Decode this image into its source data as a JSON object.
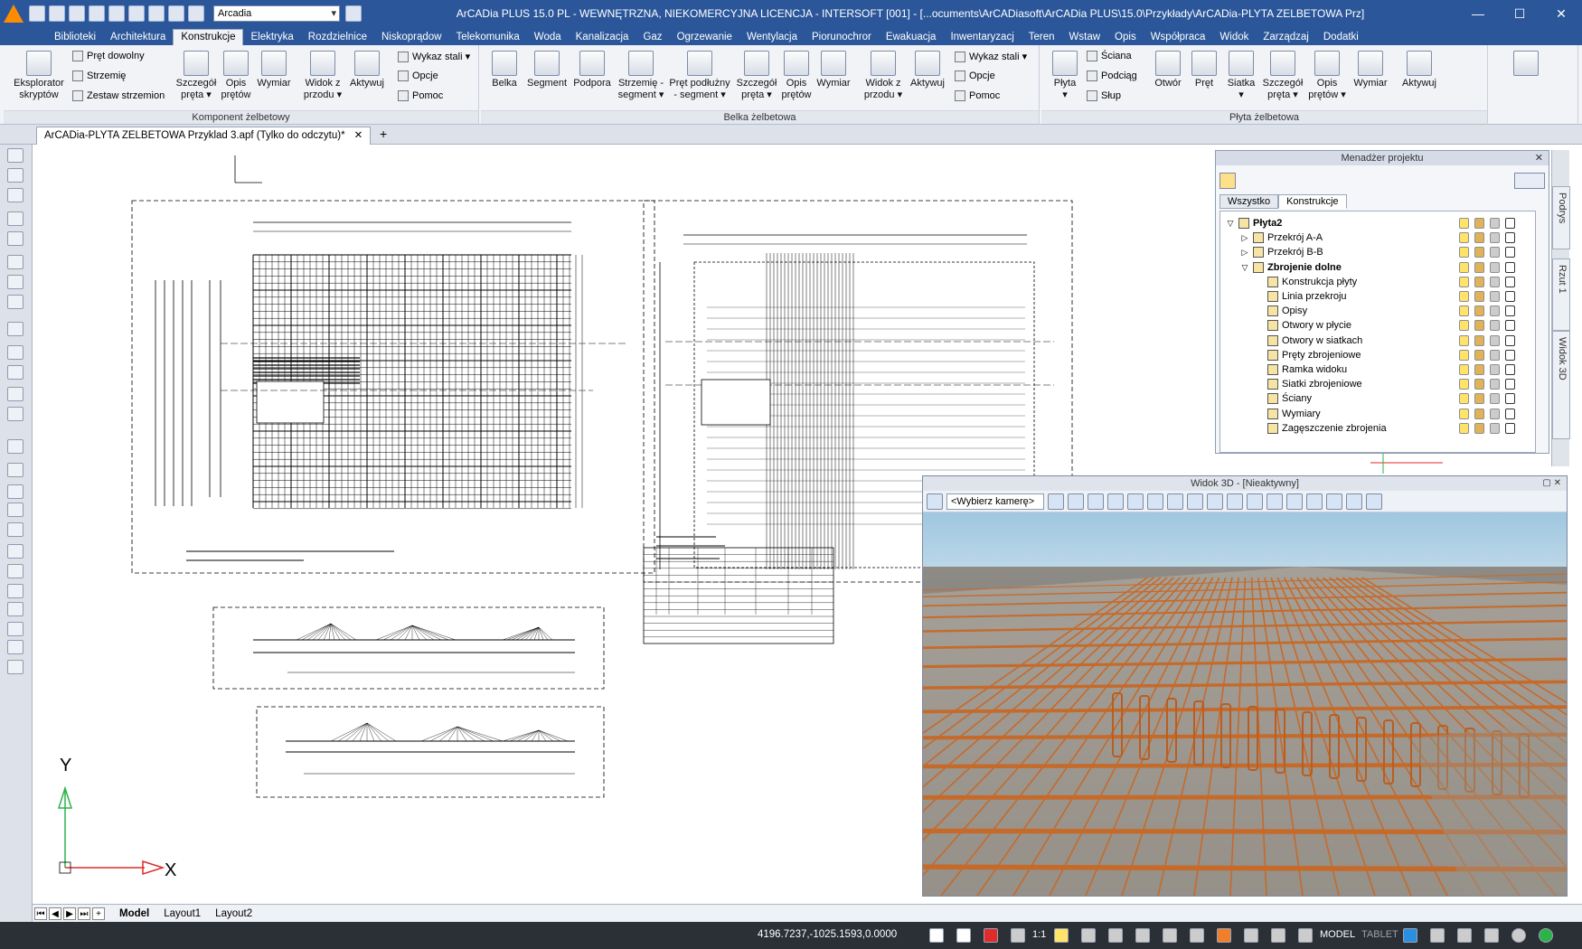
{
  "window": {
    "title": "ArCADia PLUS 15.0 PL - WEWNĘTRZNA, NIEKOMERCYJNA LICENCJA - INTERSOFT [001] - [...ocuments\\ArCADiasoft\\ArCADia PLUS\\15.0\\Przykłady\\ArCADia-PLYTA ZELBETOWA Prz]",
    "workspace": "Arcadia",
    "minimize": "—",
    "maximize": "☐",
    "close": "✕"
  },
  "menu": {
    "tabs": [
      "Biblioteki",
      "Architektura",
      "Konstrukcje",
      "Elektryka",
      "Rozdzielnice",
      "Niskoprądow",
      "Telekomunika",
      "Woda",
      "Kanalizacja",
      "Gaz",
      "Ogrzewanie",
      "Wentylacja",
      "Piorunochror",
      "Ewakuacja",
      "Inwentaryzacj",
      "Teren",
      "Wstaw",
      "Opis",
      "Współpraca",
      "Widok",
      "Zarządzaj",
      "Dodatki"
    ],
    "active": "Konstrukcje"
  },
  "ribbon": {
    "komponent": {
      "label": "Komponent żelbetowy",
      "eksplorator": "Eksplorator\nskryptów",
      "pret_dowolny": "Pręt dowolny",
      "strzemie": "Strzemię",
      "zestaw": "Zestaw strzemion",
      "szczegol": "Szczegół\npręta ▾",
      "opis": "Opis\nprętów",
      "wymiar": "Wymiar",
      "widok": "Widok z\nprzodu ▾",
      "aktywuj": "Aktywuj",
      "wykaz": "Wykaz stali ▾",
      "opcje": "Opcje",
      "pomoc": "Pomoc"
    },
    "belka": {
      "label": "Belka żelbetowa",
      "belka": "Belka",
      "segment": "Segment",
      "podpora": "Podpora",
      "strzemie_seg": "Strzemię -\nsegment ▾",
      "pret_podl": "Pręt podłużny\n- segment ▾",
      "szczegol": "Szczegół\npręta ▾",
      "opis": "Opis\nprętów",
      "wymiar": "Wymiar",
      "widok": "Widok z\nprzodu ▾",
      "aktywuj": "Aktywuj",
      "wykaz": "Wykaz stali ▾",
      "opcje": "Opcje",
      "pomoc": "Pomoc"
    },
    "plyta": {
      "label": "Płyta żelbetowa",
      "plyta": "Płyta\n▾",
      "sciana": "Ściana",
      "podciag": "Podciąg",
      "slup": "Słup",
      "otwor": "Otwór",
      "pret": "Pręt",
      "siatka": "Siatka\n▾",
      "szczegol": "Szczegół\npręta ▾",
      "opis": "Opis\nprętów ▾",
      "wymiar": "Wymiar",
      "aktywuj": "Aktywuj"
    }
  },
  "document": {
    "tab": "ArCADia-PLYTA ZELBETOWA Przyklad 3.apf (Tylko do odczytu)*",
    "close": "✕",
    "add": "+"
  },
  "project_manager": {
    "title": "Menadżer projektu",
    "close": "✕",
    "tabs": [
      "Wszystko",
      "Konstrukcje"
    ],
    "active_tab": "Konstrukcje",
    "tree": [
      {
        "label": "Płyta2",
        "level": 0,
        "toggle": "▽",
        "bold": true
      },
      {
        "label": "Przekrój A-A",
        "level": 1,
        "toggle": "▷",
        "bold": false
      },
      {
        "label": "Przekrój B-B",
        "level": 1,
        "toggle": "▷",
        "bold": false
      },
      {
        "label": "Zbrojenie dolne",
        "level": 1,
        "toggle": "▽",
        "bold": true
      },
      {
        "label": "Konstrukcja płyty",
        "level": 2,
        "toggle": "",
        "bold": false
      },
      {
        "label": "Linia przekroju",
        "level": 2,
        "toggle": "",
        "bold": false
      },
      {
        "label": "Opisy",
        "level": 2,
        "toggle": "",
        "bold": false
      },
      {
        "label": "Otwory w płycie",
        "level": 2,
        "toggle": "",
        "bold": false
      },
      {
        "label": "Otwory w siatkach",
        "level": 2,
        "toggle": "",
        "bold": false
      },
      {
        "label": "Pręty zbrojeniowe",
        "level": 2,
        "toggle": "",
        "bold": false
      },
      {
        "label": "Ramka widoku",
        "level": 2,
        "toggle": "",
        "bold": false
      },
      {
        "label": "Siatki zbrojeniowe",
        "level": 2,
        "toggle": "",
        "bold": false
      },
      {
        "label": "Ściany",
        "level": 2,
        "toggle": "",
        "bold": false
      },
      {
        "label": "Wymiary",
        "level": 2,
        "toggle": "",
        "bold": false
      },
      {
        "label": "Zagęszczenie zbrojenia",
        "level": 2,
        "toggle": "",
        "bold": false
      }
    ]
  },
  "side_tabs": [
    "Podrys",
    "Rzut 1",
    "Widok 3D"
  ],
  "view3d": {
    "title": "Widok 3D - [Nieaktywny]",
    "camera": "<Wybierz kamerę>",
    "ctrls": "▢ ✕"
  },
  "drawing": {
    "axis_y": "Y",
    "axis_x": "X"
  },
  "layouts": {
    "tabs": [
      "Model",
      "Layout1",
      "Layout2"
    ],
    "active": "Model"
  },
  "statusbar": {
    "coords": "4196.7237,-1025.1593,0.0000",
    "scale": "1:1",
    "model": "MODEL",
    "tablet": "TABLET"
  }
}
